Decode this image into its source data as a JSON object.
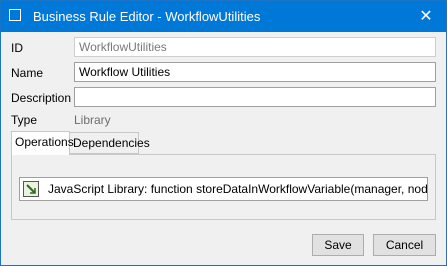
{
  "window": {
    "title": "Business Rule Editor - WorkflowUtilities",
    "close_glyph": "✕"
  },
  "form": {
    "id_label": "ID",
    "id_value": "WorkflowUtilities",
    "name_label": "Name",
    "name_value": "Workflow Utilities",
    "description_label": "Description",
    "description_value": "",
    "type_label": "Type",
    "type_value": "Library"
  },
  "tabs": [
    {
      "label": "Operations",
      "active": true
    },
    {
      "label": "Dependencies",
      "active": false
    }
  ],
  "operations": {
    "items": [
      {
        "text": "JavaScript Library: function storeDataInWorkflowVariable(manager, node, wo",
        "icon": "javascript-library-icon"
      }
    ]
  },
  "buttons": {
    "save": "Save",
    "cancel": "Cancel"
  },
  "colors": {
    "titlebar": "#0078d7",
    "window_bg": "#f0f0f0"
  }
}
